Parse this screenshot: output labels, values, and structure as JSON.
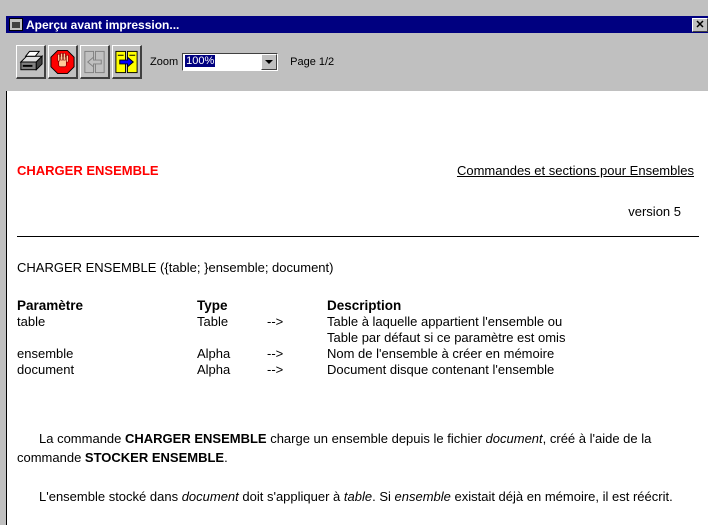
{
  "window": {
    "title": "Aperçu avant impression...",
    "close_glyph": "✕"
  },
  "toolbar": {
    "buttons": [
      {
        "name": "print-icon"
      },
      {
        "name": "stop-icon"
      },
      {
        "name": "previous-page-icon"
      },
      {
        "name": "next-page-icon"
      }
    ],
    "zoom_label": "Zoom",
    "zoom_value": "100%",
    "page_label": "Page 1/2"
  },
  "document": {
    "title": "CHARGER ENSEMBLE",
    "title_color": "#ff0000",
    "section": "Commandes et sections pour Ensembles",
    "version": "version 5",
    "syntax": "CHARGER ENSEMBLE ({table; }ensemble; document)",
    "params_header": {
      "param": "Paramètre",
      "type": "Type",
      "description": "Description"
    },
    "params": [
      {
        "param": "table",
        "type": "Table",
        "arrow": "-->",
        "description": "Table à laquelle appartient l'ensemble ou"
      },
      {
        "param": "",
        "type": "",
        "arrow": "",
        "description": "Table par défaut si ce paramètre est omis"
      },
      {
        "param": "ensemble",
        "type": "Alpha",
        "arrow": "-->",
        "description": "Nom de l'ensemble à créer en mémoire"
      },
      {
        "param": "document",
        "type": "Alpha",
        "arrow": "-->",
        "description": "Document disque contenant l'ensemble"
      }
    ],
    "para1": {
      "t1": "La commande ",
      "b1": "CHARGER ENSEMBLE",
      "t2": " charge un ensemble depuis le fichier ",
      "i1": "document",
      "t3": ", créé à l'aide de la commande ",
      "b2": "STOCKER ENSEMBLE",
      "t4": "."
    },
    "para2": {
      "t1": "L'ensemble stocké dans ",
      "i1": "document",
      "t2": " doit s'appliquer à ",
      "i2": "table",
      "t3": ". Si ",
      "i3": "ensemble",
      "t4": " existait déjà en mémoire, il est réécrit."
    }
  }
}
